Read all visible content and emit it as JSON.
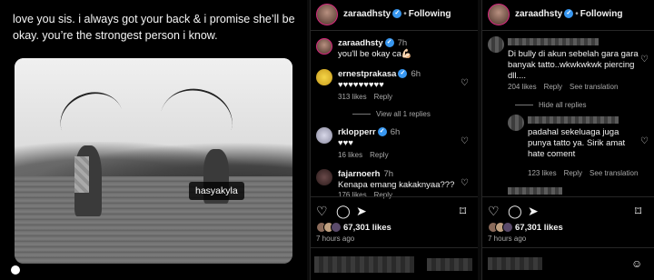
{
  "post": {
    "caption": "love you sis. i always got your back & i promise she’ll be okay. you’re the strongest person i know.",
    "photo_tag": "hasyakyla"
  },
  "middle": {
    "header": {
      "username": "zaraadhsty",
      "dot": "•",
      "follow": "Following"
    },
    "comments": [
      {
        "user": "zaraadhsty",
        "time": "7h",
        "text": "you'll be okay ca💪🏻"
      },
      {
        "user": "ernestprakasa",
        "time": "6h",
        "text": "♥♥♥♥♥♥♥♥♥",
        "meta_likes": "313 likes",
        "meta_reply": "Reply"
      },
      {
        "user": "rklopperr",
        "time": "6h",
        "text": "♥♥♥",
        "meta_likes": "16 likes",
        "meta_reply": "Reply"
      },
      {
        "user": "fajarnoerh",
        "time": "7h",
        "text": "Kenapa emang kakaknyaa???",
        "meta_likes": "176 likes",
        "meta_reply": "Reply"
      }
    ],
    "view_replies": "View all 1 replies",
    "likes": "67,301 likes",
    "ago": "7 hours ago"
  },
  "right": {
    "header": {
      "username": "zaraadhsty",
      "dot": "•",
      "follow": "Following"
    },
    "comment1": {
      "text": "Di bully di akun sebelah gara gara banyak tatto..wkwkwkwk piercing dll....",
      "meta_likes": "204 likes",
      "meta_reply": "Reply",
      "meta_translate": "See translation"
    },
    "hide_replies": "Hide all replies",
    "comment2": {
      "text": "padahal sekeluaga juga punya tatto ya. Sirik amat hate coment",
      "meta_likes": "123 likes",
      "meta_reply": "Reply",
      "meta_translate": "See translation"
    },
    "likes": "67,301 likes",
    "ago": "7 hours ago"
  },
  "colors": {
    "accent_blue": "#3897f0",
    "heart_red": "#ed2b3e",
    "muted": "#a8a8a8"
  }
}
